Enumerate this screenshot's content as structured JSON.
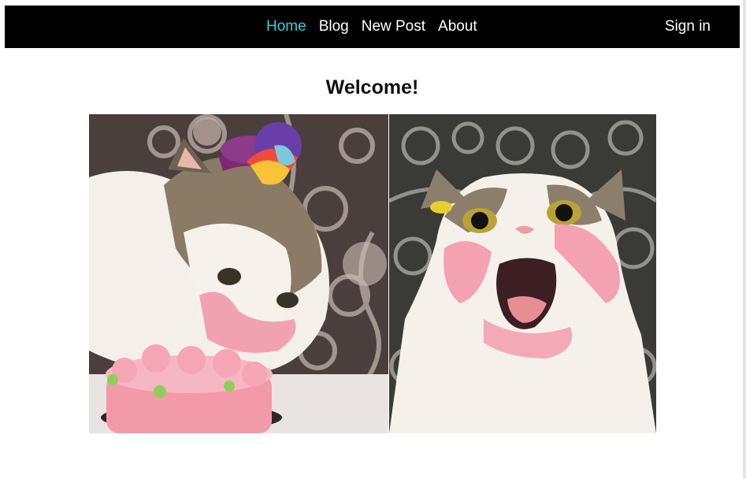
{
  "nav": {
    "links": [
      {
        "label": "Home",
        "active": true
      },
      {
        "label": "Blog",
        "active": false
      },
      {
        "label": "New Post",
        "active": false
      },
      {
        "label": "About",
        "active": false
      }
    ],
    "signin_label": "Sign in"
  },
  "main": {
    "title": "Welcome!",
    "image_icons": [
      "cat-eating-cake-image",
      "cat-open-mouth-image"
    ]
  },
  "colors": {
    "navbar_bg": "#000000",
    "nav_text": "#ffffff",
    "nav_active": "#29d3dc"
  }
}
